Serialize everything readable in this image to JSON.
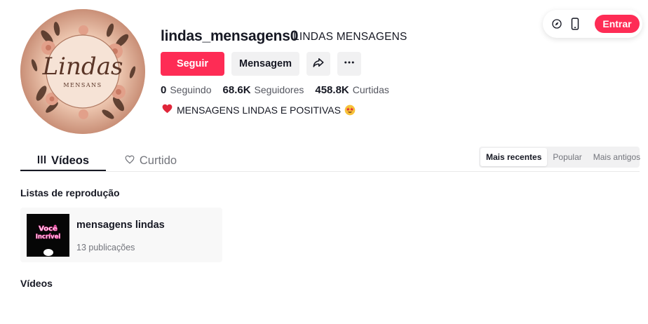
{
  "profile": {
    "username": "lindas_mensagens0",
    "nickname": "LINDAS MENSAGENS",
    "avatar": {
      "logo_word": "Lindas",
      "logo_sub": "MENSANS"
    }
  },
  "actions": {
    "follow_label": "Seguir",
    "message_label": "Mensagem",
    "share_icon": "share-icon",
    "more_icon": "more-icon"
  },
  "stats": {
    "following_count": "0",
    "following_label": "Seguindo",
    "followers_count": "68.6K",
    "followers_label": "Seguidores",
    "likes_count": "458.8K",
    "likes_label": "Curtidas"
  },
  "bio": {
    "text": "MENSAGENS LINDAS E POSITIVAS"
  },
  "topbar": {
    "login_label": "Entrar",
    "compass_icon": "compass-icon",
    "phone_icon": "phone-icon"
  },
  "tabs": [
    {
      "label": "Vídeos",
      "active": true
    },
    {
      "label": "Curtido",
      "active": false
    }
  ],
  "sort_options": [
    {
      "label": "Mais recentes",
      "active": true
    },
    {
      "label": "Popular",
      "active": false
    },
    {
      "label": "Mais antigos",
      "active": false
    }
  ],
  "playlists_section": {
    "title": "Listas de reprodução",
    "items": [
      {
        "title": "mensagens lindas",
        "count": "13 publicações",
        "thumb_text": "Você Incrível"
      }
    ]
  },
  "videos_section": {
    "title": "Vídeos"
  },
  "colors": {
    "accent": "#fe2c55",
    "text": "#161823",
    "muted": "#73757c",
    "surface": "#f1f1f2"
  }
}
